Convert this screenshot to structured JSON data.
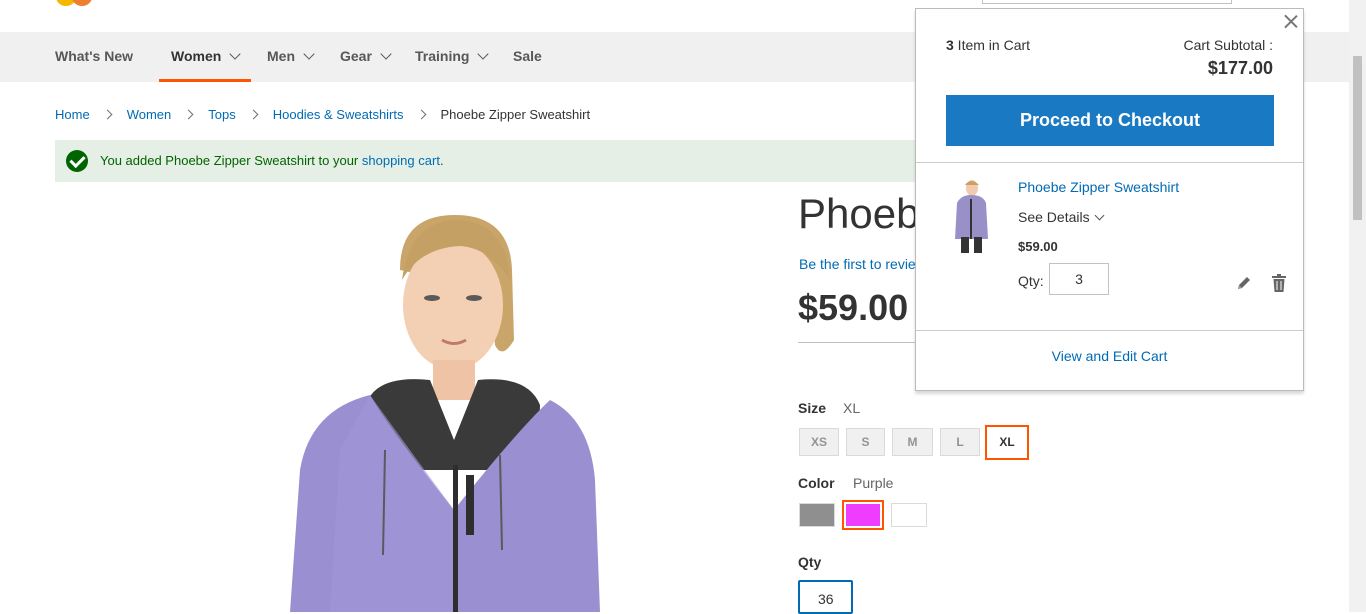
{
  "nav": {
    "items": [
      {
        "label": "What's New",
        "dropdown": false
      },
      {
        "label": "Women",
        "dropdown": true,
        "active": true
      },
      {
        "label": "Men",
        "dropdown": true
      },
      {
        "label": "Gear",
        "dropdown": true
      },
      {
        "label": "Training",
        "dropdown": true
      },
      {
        "label": "Sale",
        "dropdown": false
      }
    ]
  },
  "breadcrumbs": [
    "Home",
    "Women",
    "Tops",
    "Hoodies & Sweatshirts",
    "Phoebe Zipper Sweatshirt"
  ],
  "message": {
    "prefix": "You added Phoebe Zipper Sweatshirt to your ",
    "link": "shopping cart",
    "suffix": "."
  },
  "product": {
    "title": "Phoebe Zipper Sweatshirt",
    "review_link": "Be the first to review this product",
    "price": "$59.00",
    "size_label": "Size",
    "size_selected": "XL",
    "sizes": [
      "XS",
      "S",
      "M",
      "L",
      "XL"
    ],
    "color_label": "Color",
    "color_selected": "Purple",
    "colors": [
      "#8f8f8f",
      "#ef3dff",
      "#ffffff"
    ],
    "qty_label": "Qty",
    "qty_value": "36"
  },
  "minicart": {
    "count": "3",
    "count_suffix": " Item in Cart",
    "subtotal_label": "Cart Subtotal :",
    "subtotal": "$177.00",
    "checkout_label": "Proceed to Checkout",
    "item": {
      "name": "Phoebe Zipper Sweatshirt",
      "see_details": "See Details",
      "price": "$59.00",
      "qty_label": "Qty:",
      "qty": "3"
    },
    "view_edit": "View and Edit Cart"
  },
  "colors": {
    "accent": "#ff5501",
    "link": "#006bb4",
    "button": "#1979c3",
    "success_bg": "#e5efe5"
  }
}
